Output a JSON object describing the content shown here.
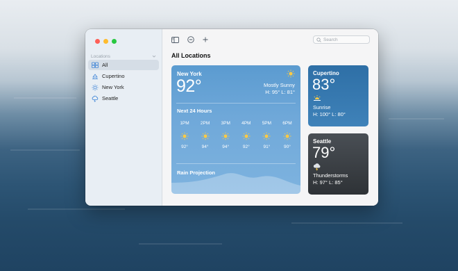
{
  "sidebar": {
    "section_label": "Locations",
    "items": [
      {
        "label": "All",
        "icon": "all-locations-icon",
        "active": true
      },
      {
        "label": "Cupertino",
        "icon": "partly-cloudy-icon"
      },
      {
        "label": "New York",
        "icon": "sun-icon"
      },
      {
        "label": "Seattle",
        "icon": "thunderstorm-icon"
      }
    ]
  },
  "toolbar": {
    "sidebar_toggle_icon": "sidebar-toggle-icon",
    "remove_icon": "minus-circle-icon",
    "add_icon": "plus-icon",
    "search_placeholder": "Search"
  },
  "main": {
    "title": "All Locations",
    "new_york": {
      "city": "New York",
      "temp": "92°",
      "condition": "Mostly Sunny",
      "hilo": "H: 95° L: 81°",
      "next_label": "Next 24 Hours",
      "hours": [
        {
          "time": "1PM",
          "temp": "92°"
        },
        {
          "time": "2PM",
          "temp": "94°"
        },
        {
          "time": "3PM",
          "temp": "94°"
        },
        {
          "time": "4PM",
          "temp": "92°"
        },
        {
          "time": "5PM",
          "temp": "91°"
        },
        {
          "time": "6PM",
          "temp": "90°"
        }
      ],
      "rain_label": "Rain Projection"
    },
    "cupertino": {
      "city": "Cupertino",
      "temp": "83°",
      "condition": "Sunrise",
      "hilo": "H: 100° L: 80°"
    },
    "seattle": {
      "city": "Seattle",
      "temp": "79°",
      "condition": "Thunderstorms",
      "hilo": "H: 97° L: 85°"
    }
  },
  "colors": {
    "sun": "#f7c948",
    "ny_card": "#6fa8d9",
    "cupertino_card": "#3a7cb3",
    "seattle_card": "#3a3e43"
  }
}
